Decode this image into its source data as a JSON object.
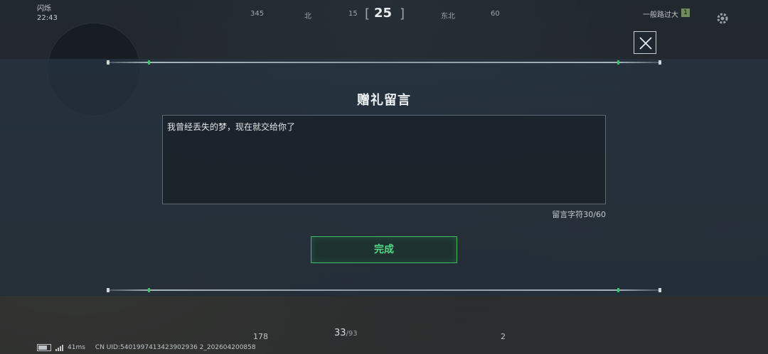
{
  "hud": {
    "time_top": "闪烁",
    "time": "22:43",
    "compass": {
      "heading": "25",
      "ticks": [
        "345",
        "北",
        "15",
        "东北",
        "60"
      ]
    },
    "top_right_label": "一般路过大",
    "top_right_badge": "1",
    "ping": "41ms",
    "uid": "CN UID:5401997413423902936 2_202604200858",
    "ammo_current": "33",
    "ammo_reserve": "/93",
    "count_left": "178",
    "count_right": "2"
  },
  "modal": {
    "title": "赠礼留言",
    "message": "我曾经丢失的梦，现在就交给你了",
    "char_counter": "留言字符30/60",
    "confirm_label": "完成"
  },
  "colors": {
    "accent_green": "#3fb86a",
    "confirm_text": "#56d685"
  }
}
